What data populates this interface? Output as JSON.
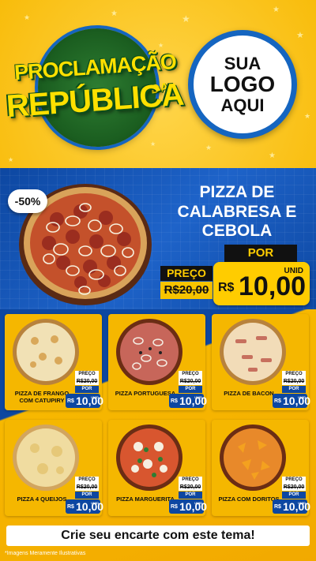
{
  "header": {
    "event_line1": "PROCLAMAÇÃO",
    "event_da": "DA",
    "event_line2": "REPÚBLICA",
    "logo_line1": "SUA",
    "logo_line2": "LOGO",
    "logo_line3": "AQUI"
  },
  "featured": {
    "discount": "-50%",
    "name": "PIZZA DE CALABRESA E CEBOLA",
    "por_label": "POR",
    "preco_label": "PREÇO",
    "old_price": "R$20,00",
    "currency": "R$",
    "new_price": "10,00",
    "unit": "UNID"
  },
  "card_labels": {
    "preco": "PREÇO",
    "old": "R$20,00",
    "por": "POR",
    "currency": "R$",
    "price": "10,00",
    "unit": "UNID"
  },
  "products": [
    {
      "name": "PIZZA DE FRANGO COM CATUPIRY"
    },
    {
      "name": "PIZZA PORTUGUESA"
    },
    {
      "name": "PIZZA DE BACON"
    },
    {
      "name": "PIZZA 4 QUEIJOS"
    },
    {
      "name": "PIZZA MARGUERITA"
    },
    {
      "name": "PIZZA COM DORITOS"
    }
  ],
  "footer": {
    "cta": "Crie seu encarte com este tema!",
    "disclaimer": "*Imagens Meramente Ilustrativas"
  },
  "colors": {
    "brand_blue": "#0d47a1",
    "brand_yellow": "#f7b800",
    "brand_green": "#1b5e20"
  }
}
